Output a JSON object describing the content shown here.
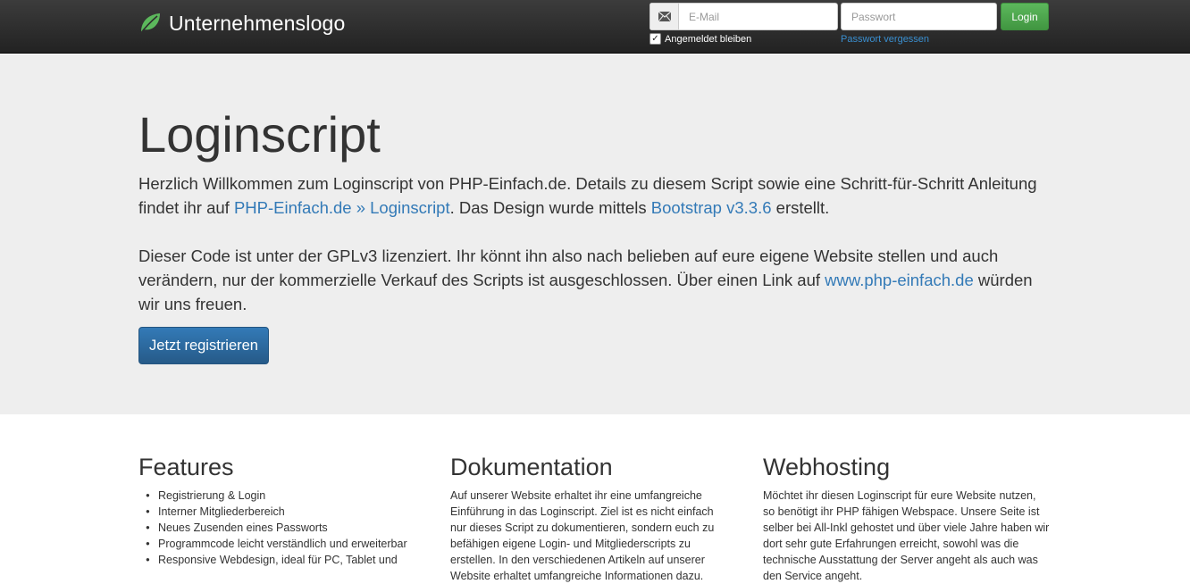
{
  "navbar": {
    "brand": "Unternehmenslogo",
    "email_placeholder": "E-Mail",
    "password_placeholder": "Passwort",
    "login_label": "Login",
    "remember_label": "Angemeldet bleiben",
    "forgot_label": "Passwort vergessen",
    "colors": {
      "login": "#5cb85c",
      "brand_leaf": "#5cb85c"
    }
  },
  "jumbotron": {
    "title": "Loginscript",
    "p1_a": "Herzlich Willkommen zum Loginscript von PHP-Einfach.de. Details zu diesem Script sowie eine Schritt-für-Schritt Anleitung findet ihr auf ",
    "p1_link1": "PHP-Einfach.de » Loginscript",
    "p1_b": ". Das Design wurde mittels ",
    "p1_link2": "Bootstrap v3.3.6",
    "p1_c": " erstellt.",
    "p2_a": "Dieser Code ist unter der GPLv3 lizenziert. Ihr könnt ihn also nach belieben auf eure eigene Website stellen und auch verändern, nur der kommerzielle Verkauf des Scripts ist ausgeschlossen. Über einen Link auf ",
    "p2_link": "www.php-einfach.de",
    "p2_b": " würden wir uns freuen.",
    "register_label": "Jetzt registrieren"
  },
  "features": {
    "title": "Features",
    "items": [
      "Registrierung & Login",
      "Interner Mitgliederbereich",
      "Neues Zusenden eines Passworts",
      "Programmcode leicht verständlich und erweiterbar",
      "Responsive Webdesign, ideal für PC, Tablet und"
    ]
  },
  "dokumentation": {
    "title": "Dokumentation",
    "text": "Auf unserer Website erhaltet ihr eine umfangreiche Einführung in das Loginscript. Ziel ist es nicht einfach nur dieses Script zu dokumentieren, sondern euch zu befähigen eigene Login- und Mitgliederscripts zu erstellen. In den verschiedenen Artikeln auf unserer Website erhaltet umfangreiche Informationen dazu."
  },
  "webhosting": {
    "title": "Webhosting",
    "text": "Möchtet ihr diesen Loginscript für eure Website nutzen, so benötigt ihr PHP fähigen Webspace. Unsere Seite ist selber bei All-Inkl gehostet und über viele Jahre haben wir dort sehr gute Erfahrungen erreicht, sowohl was die technische Ausstattung der Server angeht als auch was den Service angeht."
  }
}
